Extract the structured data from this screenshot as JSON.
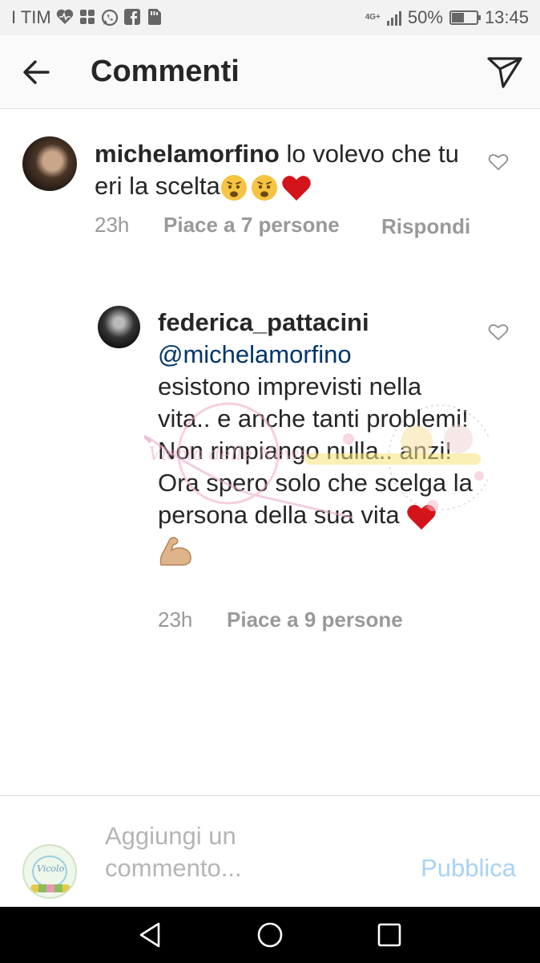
{
  "status_bar": {
    "carrier": "I TIM",
    "network": "4G+",
    "battery": "50%",
    "battery_level": 0.5,
    "time": "13:45",
    "icons": [
      "heart-monitor-icon",
      "apps-icon",
      "whatsapp-icon",
      "facebook-icon",
      "sim-icon"
    ]
  },
  "header": {
    "title": "Commenti",
    "back_icon": "arrow-left-icon",
    "send_icon": "paper-plane-icon"
  },
  "comments": [
    {
      "username": "michelamorfino",
      "text": "lo volevo che tu eri la scelta",
      "emojis": [
        "worried-face",
        "worried-face",
        "red-heart"
      ],
      "time": "23h",
      "likes": "Piace a 7 persone",
      "reply": "Rispondi"
    },
    {
      "username": "federica_pattacini",
      "mention": "@michelamorfino",
      "text": "esistono imprevisti nella vita.. e anche tanti problemi! Non rimpiango nulla.. anzi! Ora spero solo che scelga la persona della sua vita",
      "emojis": [
        "red-heart",
        "flexed-biceps"
      ],
      "time": "23h",
      "likes": "Piace a 9 persone"
    }
  ],
  "composer": {
    "placeholder": "Aggiungi un commento...",
    "publish_label": "Pubblica",
    "avatar_text": "Vicolo"
  },
  "watermark": {
    "text": "Vicolo delle News"
  },
  "colors": {
    "header_bg": "#fafafa",
    "text": "#262626",
    "meta": "#999999",
    "mention": "#003569",
    "publish_disabled": "#a7d3f7",
    "nav_bg": "#000000"
  }
}
